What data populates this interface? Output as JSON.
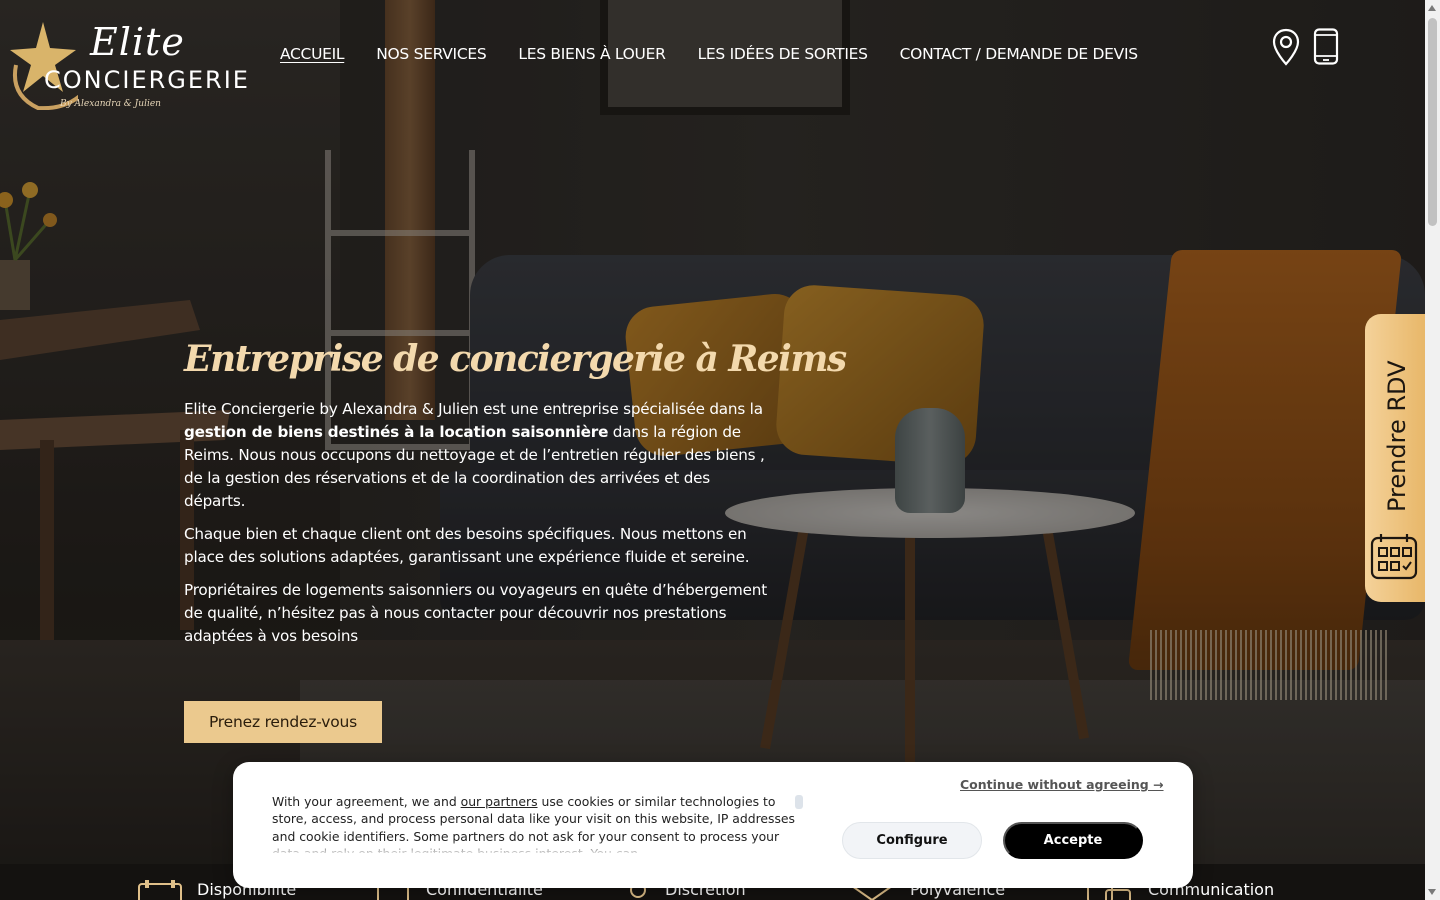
{
  "brand": {
    "logo_name": "Elite",
    "logo_subtitle": "CONCIERGERIE",
    "logo_by": "By Alexandra & Julien"
  },
  "nav": {
    "items": [
      {
        "label": "ACCUEIL",
        "active": true
      },
      {
        "label": "NOS SERVICES",
        "active": false
      },
      {
        "label": "LES BIENS À LOUER",
        "active": false
      },
      {
        "label": "LES IDÉES DE SORTIES",
        "active": false
      },
      {
        "label": "CONTACT / DEMANDE DE DEVIS",
        "active": false
      }
    ]
  },
  "header_icons": [
    "location-pin-icon",
    "mobile-phone-icon"
  ],
  "hero": {
    "title": "Entreprise de conciergerie à Reims",
    "p1_a": "Elite Conciergerie by Alexandra & Julien est une entreprise spécialisée dans la ",
    "p1_bold": "gestion de biens destinés à la location saisonnière",
    "p1_b": " dans la région de Reims. Nous nous occupons du  nettoyage et de  l’entretien régulier des biens , de la gestion des réservations et de la coordination des arrivées et des départs.",
    "p2": "Chaque bien et chaque client ont des besoins spécifiques. Nous mettons en place des solutions adaptées, garantissant une expérience fluide et sereine.",
    "p3": "Propriétaires de logements saisonniers ou voyageurs en quête d’hébergement de qualité, n’hésitez pas à nous contacter pour découvrir nos prestations adaptées à vos besoins",
    "cta_label": "Prenez rendez-vous"
  },
  "side_tab": {
    "label": "Prendre RDV",
    "icon": "calendar-icon"
  },
  "features": [
    {
      "label": "Disponibilité",
      "icon": "calendar-icon"
    },
    {
      "label": "Confidentialité",
      "icon": "document-icon"
    },
    {
      "label": "Discrétion",
      "icon": "person-icon"
    },
    {
      "label": "Polyvalence",
      "icon": "tools-icon"
    },
    {
      "label": "Communication",
      "icon": "chat-icon"
    }
  ],
  "cookie": {
    "text_a": "With your agreement, we and ",
    "link": "our partners",
    "text_b": " use cookies or similar technologies to store, access, and process personal data like your visit on this website, IP addresses and cookie identifiers. Some partners do not ask for your consent to process your data and rely on their legitimate business interest. You can",
    "continue_label": "Continue without agreeing →",
    "configure_label": "Configure",
    "accept_label": "Accepte"
  },
  "colors": {
    "accent_gold": "#ebc98e",
    "title_gold": "#f3d9ad",
    "accept_black": "#000000"
  }
}
